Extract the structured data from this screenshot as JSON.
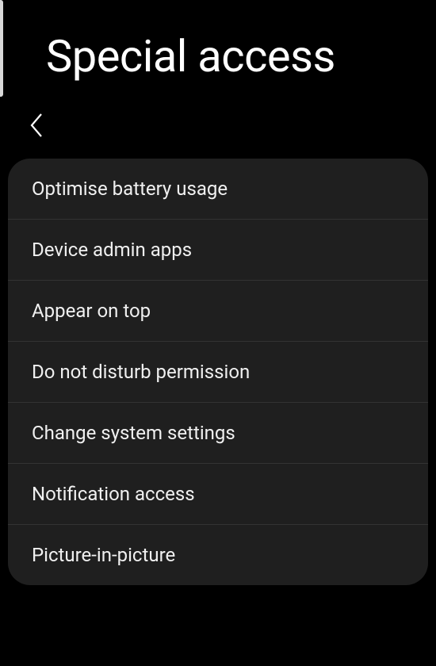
{
  "header": {
    "title": "Special access"
  },
  "list": {
    "items": [
      {
        "label": "Optimise battery usage"
      },
      {
        "label": "Device admin apps"
      },
      {
        "label": "Appear on top"
      },
      {
        "label": "Do not disturb permission"
      },
      {
        "label": "Change system settings"
      },
      {
        "label": "Notification access"
      },
      {
        "label": "Picture-in-picture"
      }
    ]
  }
}
